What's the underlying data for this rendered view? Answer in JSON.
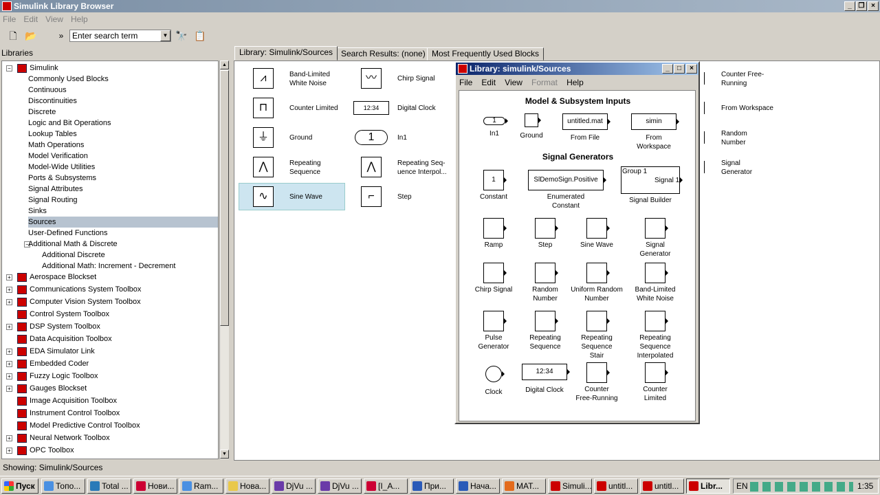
{
  "window": {
    "title": "Simulink Library Browser"
  },
  "menu": [
    "File",
    "Edit",
    "View",
    "Help"
  ],
  "toolbar": {
    "search_placeholder": "Enter search term"
  },
  "libraries_header": "Libraries",
  "tree": [
    {
      "label": "Simulink",
      "level": 0,
      "expander": "-",
      "icon": true
    },
    {
      "label": "Commonly Used Blocks",
      "level": 1
    },
    {
      "label": "Continuous",
      "level": 1
    },
    {
      "label": "Discontinuities",
      "level": 1
    },
    {
      "label": "Discrete",
      "level": 1
    },
    {
      "label": "Logic and Bit Operations",
      "level": 1
    },
    {
      "label": "Lookup Tables",
      "level": 1
    },
    {
      "label": "Math Operations",
      "level": 1
    },
    {
      "label": "Model Verification",
      "level": 1
    },
    {
      "label": "Model-Wide Utilities",
      "level": 1
    },
    {
      "label": "Ports & Subsystems",
      "level": 1
    },
    {
      "label": "Signal Attributes",
      "level": 1
    },
    {
      "label": "Signal Routing",
      "level": 1
    },
    {
      "label": "Sinks",
      "level": 1
    },
    {
      "label": "Sources",
      "level": 1,
      "selected": true
    },
    {
      "label": "User-Defined Functions",
      "level": 1
    },
    {
      "label": "Additional Math & Discrete",
      "level": 1,
      "expander": "-"
    },
    {
      "label": "Additional Discrete",
      "level": 2
    },
    {
      "label": "Additional Math: Increment - Decrement",
      "level": 2
    },
    {
      "label": "Aerospace Blockset",
      "level": 0,
      "expander": "+",
      "icon": true
    },
    {
      "label": "Communications System Toolbox",
      "level": 0,
      "expander": "+",
      "icon": true
    },
    {
      "label": "Computer Vision System Toolbox",
      "level": 0,
      "expander": "+",
      "icon": true
    },
    {
      "label": "Control System Toolbox",
      "level": 0,
      "expander": "",
      "icon": true
    },
    {
      "label": "DSP System Toolbox",
      "level": 0,
      "expander": "+",
      "icon": true
    },
    {
      "label": "Data Acquisition Toolbox",
      "level": 0,
      "expander": "",
      "icon": true
    },
    {
      "label": "EDA Simulator Link",
      "level": 0,
      "expander": "+",
      "icon": true
    },
    {
      "label": "Embedded Coder",
      "level": 0,
      "expander": "+",
      "icon": true
    },
    {
      "label": "Fuzzy Logic Toolbox",
      "level": 0,
      "expander": "+",
      "icon": true
    },
    {
      "label": "Gauges Blockset",
      "level": 0,
      "expander": "+",
      "icon": true
    },
    {
      "label": "Image Acquisition Toolbox",
      "level": 0,
      "expander": "",
      "icon": true
    },
    {
      "label": "Instrument Control Toolbox",
      "level": 0,
      "expander": "",
      "icon": true
    },
    {
      "label": "Model Predictive Control Toolbox",
      "level": 0,
      "expander": "",
      "icon": true
    },
    {
      "label": "Neural Network Toolbox",
      "level": 0,
      "expander": "+",
      "icon": true
    },
    {
      "label": "OPC Toolbox",
      "level": 0,
      "expander": "+",
      "icon": true
    }
  ],
  "tabs": [
    "Library: Simulink/Sources",
    "Search Results: (none)",
    "Most Frequently Used Blocks"
  ],
  "main_blocks": [
    {
      "label": "Band-Limited\nWhite Noise",
      "glyph": "⩘"
    },
    {
      "label": "Chirp Signal",
      "glyph": "〰"
    },
    {
      "label": "Counter Limited",
      "glyph": "⊓"
    },
    {
      "label": "Digital Clock",
      "glyph": "12:34"
    },
    {
      "label": "Ground",
      "glyph": "⏚"
    },
    {
      "label": "In1",
      "glyph": "1"
    },
    {
      "label": "Repeating\nSequence",
      "glyph": "⋀"
    },
    {
      "label": "Repeating Seq-\nuence Interpol...",
      "glyph": "⋀"
    },
    {
      "label": "Sine Wave",
      "glyph": "∿"
    },
    {
      "label": "Step",
      "glyph": "⌐"
    },
    {
      "label": "Counter Free-\nRunning",
      "glyph": "⊓"
    },
    {
      "label": "From Workspace",
      "glyph": ""
    },
    {
      "label": "Random\nNumber",
      "glyph": ""
    },
    {
      "label": "Signal\nGenerator",
      "glyph": ""
    }
  ],
  "status": "Showing: Simulink/Sources",
  "library_window": {
    "title": "Library: simulink/Sources",
    "menu": [
      "File",
      "Edit",
      "View",
      "Format",
      "Help"
    ],
    "section1": "Model & Subsystem Inputs",
    "section2": "Signal Generators",
    "inputs": [
      {
        "label": "In1",
        "box": "1"
      },
      {
        "label": "Ground",
        "box": ""
      },
      {
        "label": "From File",
        "box": "untitled.mat"
      },
      {
        "label": "From\nWorkspace",
        "box": "simin"
      }
    ],
    "generators": [
      {
        "label": "Constant",
        "box": "1"
      },
      {
        "label": "Enumerated\nConstant",
        "box": "SlDemoSign.Positive"
      },
      {
        "label": "Signal Builder",
        "box": "Group 1",
        "extra": "Signal 1"
      },
      {
        "label": "Ramp"
      },
      {
        "label": "Step"
      },
      {
        "label": "Sine Wave"
      },
      {
        "label": "Signal\nGenerator"
      },
      {
        "label": "Chirp Signal"
      },
      {
        "label": "Random\nNumber"
      },
      {
        "label": "Uniform Random\nNumber"
      },
      {
        "label": "Band-Limited\nWhite Noise"
      },
      {
        "label": "Pulse\nGenerator"
      },
      {
        "label": "Repeating\nSequence"
      },
      {
        "label": "Repeating\nSequence\nStair"
      },
      {
        "label": "Repeating\nSequence\nInterpolated"
      },
      {
        "label": "Clock"
      },
      {
        "label": "Digital Clock",
        "box": "12:34"
      },
      {
        "label": "Counter\nFree-Running"
      },
      {
        "label": "Counter\nLimited"
      }
    ]
  },
  "taskbar": {
    "start": "Пуск",
    "items": [
      "Топо...",
      "Total ...",
      "Нови...",
      "Ram...",
      "Нова...",
      "DjVu ...",
      "DjVu ...",
      "[I_A...",
      "При...",
      "Нача...",
      "MAT...",
      "Simuli...",
      "untitl...",
      "untitl...",
      "Libr..."
    ],
    "lang": "EN",
    "clock": "1:35"
  }
}
